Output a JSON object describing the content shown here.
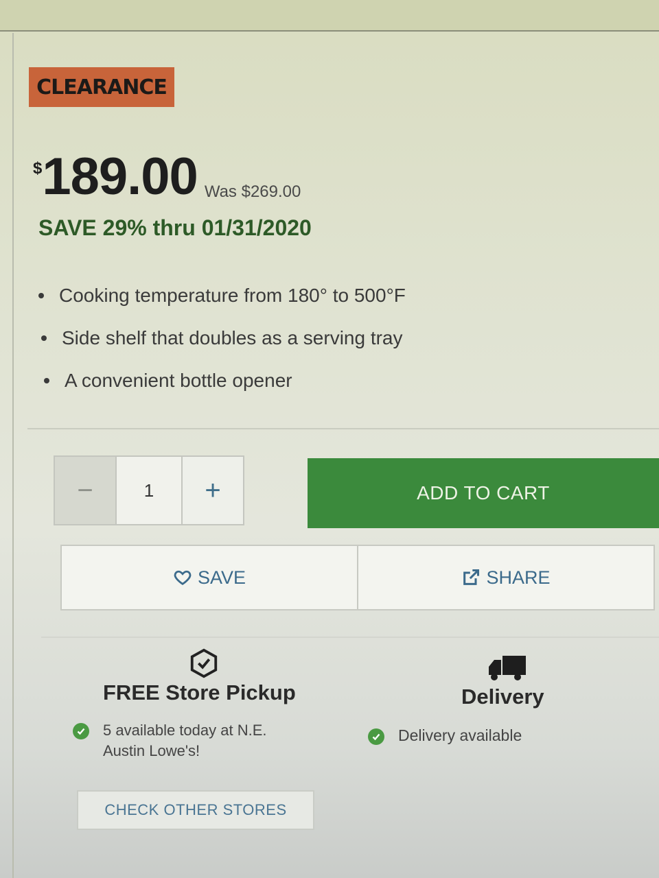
{
  "badge": {
    "label": "CLEARANCE",
    "color": "#c8643a"
  },
  "price": {
    "currency": "$",
    "amount": "189.00",
    "was": "Was $269.00",
    "save_text": "SAVE 29% thru 01/31/2020"
  },
  "features": [
    "Cooking temperature from 180° to 500°F",
    "Side shelf that doubles as a serving tray",
    "A convenient bottle opener"
  ],
  "quantity": {
    "decrement_label": "−",
    "value": "1",
    "increment_label": "+"
  },
  "add_to_cart": {
    "label": "ADD TO CART",
    "color": "#3b8a3c"
  },
  "actions": {
    "save": {
      "label": "SAVE",
      "icon": "heart-icon"
    },
    "share": {
      "label": "SHARE",
      "icon": "share-icon"
    }
  },
  "pickup": {
    "icon": "store-box-icon",
    "title": "FREE Store Pickup",
    "status_icon": "check-circle-icon",
    "status": "5 available today at N.E. Austin Lowe's!"
  },
  "delivery": {
    "icon": "truck-icon",
    "title": "Delivery",
    "status_icon": "check-circle-icon",
    "status": "Delivery available"
  },
  "check_other_stores": {
    "label": "CHECK OTHER STORES"
  }
}
